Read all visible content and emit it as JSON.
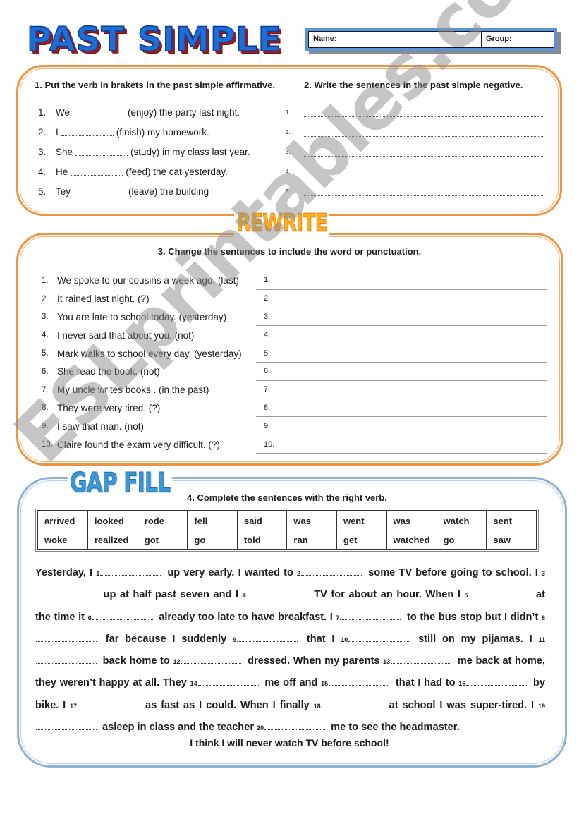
{
  "header": {
    "title": "PAST SIMPLE",
    "name_label": "Name:",
    "group_label": "Group:"
  },
  "section1": {
    "heading": "1. Put the verb in brakets in the past simple affirmative.",
    "items": [
      {
        "num": "1.",
        "before": "We",
        "after": "(enjoy) the party last night."
      },
      {
        "num": "2.",
        "before": "I",
        "after": "(finish) my homework."
      },
      {
        "num": "3.",
        "before": "She",
        "after": "(study) in my class last year."
      },
      {
        "num": "4.",
        "before": "He",
        "after": "(feed) the cat yesterday."
      },
      {
        "num": "5.",
        "before": "Tey",
        "after": "(leave) the building"
      }
    ]
  },
  "section2": {
    "heading": "2. Write the sentences in the past simple negative.",
    "lines": [
      "1.",
      "2.",
      "3.",
      "4.",
      "5."
    ]
  },
  "rewrite": {
    "stamp": "REWRITE",
    "heading": "3. Change the sentences to include the word or punctuation.",
    "items": [
      {
        "num": "1.",
        "text": "We spoke to our cousins a week ago. (last)"
      },
      {
        "num": "2.",
        "text": "It rained last night. (?)"
      },
      {
        "num": "3.",
        "text": "You are late to school today. (yesterday)"
      },
      {
        "num": "4.",
        "text": "I never said that about you. (not)"
      },
      {
        "num": "5.",
        "text": "Mark walks to school every day. (yesterday)"
      },
      {
        "num": "6.",
        "text": "She read the book. (not)"
      },
      {
        "num": "7.",
        "text": "My uncle writes books . (in the past)"
      },
      {
        "num": "8.",
        "text": "They were very tired. (?)"
      },
      {
        "num": "9.",
        "text": "I saw that man. (not)"
      },
      {
        "num": "10.",
        "text": "Claire found the exam very difficult. (?)"
      }
    ],
    "answer_lines": [
      "1.",
      "2.",
      "3.",
      "4.",
      "5.",
      "6.",
      "7.",
      "8.",
      "9.",
      "10."
    ]
  },
  "gapfill": {
    "stamp": "GAP FILL",
    "heading": "4. Complete the sentences with the right verb.",
    "word_bank": [
      [
        "arrived",
        "looked",
        "rode",
        "fell",
        "said",
        "was",
        "went",
        "was",
        "watch",
        "sent"
      ],
      [
        "woke",
        "realized",
        "got",
        "go",
        "told",
        "ran",
        "get",
        "watched",
        "go",
        "saw"
      ]
    ],
    "passage": [
      {
        "t": "Yesterday, I "
      },
      {
        "g": "1"
      },
      {
        "t": " up very early. I wanted to "
      },
      {
        "g": "2"
      },
      {
        "t": " some TV before going to school. I "
      },
      {
        "g": "3"
      },
      {
        "t": " up at half past seven and I "
      },
      {
        "g": "4"
      },
      {
        "t": " TV for about an hour. When I "
      },
      {
        "g": "5"
      },
      {
        "t": " at the time it "
      },
      {
        "g": "6"
      },
      {
        "t": " already too late to have breakfast. I "
      },
      {
        "g": "7"
      },
      {
        "t": " to the bus stop but I didn’t "
      },
      {
        "g": "8"
      },
      {
        "t": " far because I suddenly "
      },
      {
        "g": "9"
      },
      {
        "t": " that I "
      },
      {
        "g": "10"
      },
      {
        "t": " still on my pijamas. I "
      },
      {
        "g": "11"
      },
      {
        "t": " back home to "
      },
      {
        "g": "12"
      },
      {
        "t": " dressed. When my parents "
      },
      {
        "g": "13"
      },
      {
        "t": " me back at home, they weren’t happy at all. They "
      },
      {
        "g": "14"
      },
      {
        "t": " me off and "
      },
      {
        "g": "15"
      },
      {
        "t": " that I had to "
      },
      {
        "g": "16"
      },
      {
        "t": " by bike. I "
      },
      {
        "g": "17"
      },
      {
        "t": " as fast as I could. When I finally "
      },
      {
        "g": "18"
      },
      {
        "t": " at school I was super-tired. I "
      },
      {
        "g": "19"
      },
      {
        "t": " asleep in class and the teacher "
      },
      {
        "g": "20"
      },
      {
        "t": " me to see the headmaster."
      }
    ],
    "closing": "I think I will never watch TV before school!"
  },
  "watermark": "ESLprintables.com",
  "colors": {
    "title_blue": "#1d6fd6",
    "orange_border": "#f0953e",
    "blue_border": "#8fb0d8",
    "rewrite_yellow": "#ffb11f",
    "gapfill_blue": "#3f98d6"
  }
}
